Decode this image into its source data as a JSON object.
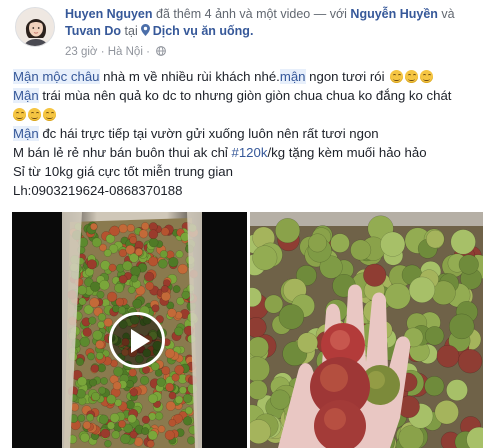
{
  "author": {
    "name": "Huyen Nguyen",
    "tagged": [
      "Nguyễn Huyền",
      "Tuvan Do"
    ]
  },
  "header": {
    "action": "đã thêm 4 ảnh và một video — với",
    "conj": "và",
    "at": "tại",
    "place": "Dịch vụ ăn uống."
  },
  "meta": {
    "time": "23 giờ",
    "sep": "·",
    "location": "Hà Nội",
    "privacy_icon": "globe-icon"
  },
  "body": {
    "l1_hl1": "Mận mộc châu",
    "l1_mid": " nhà m về nhiều rùi khách nhé.",
    "l1_hl2": "mận",
    "l1_end": " ngon tươi rói",
    "l2_hl": "Mận",
    "l2_end": " trái mùa nên quả ko dc to nhưng giòn giòn chua chua ko đắng ko chát",
    "l3_hl": "Mận",
    "l3_end": " đc hái trực tiếp tại vườn gửi xuống luôn nên rất tươi ngon",
    "l4_pre": "M bán lẻ rẻ như bán buôn thui ak chỉ ",
    "l4_tag": "#120k",
    "l4_end": "/kg tặng kèm muối hảo hảo",
    "l5": "Sỉ từ 10kg giá cực tốt miễn trung gian",
    "l6": "Lh:0903219624-0868370188"
  },
  "emoji": "smiling-face-icon",
  "media": {
    "video_icon": "play-icon"
  },
  "colors": {
    "link": "#365899",
    "highlight": "#e7effb",
    "text": "#1d2129",
    "meta": "#90949c"
  }
}
